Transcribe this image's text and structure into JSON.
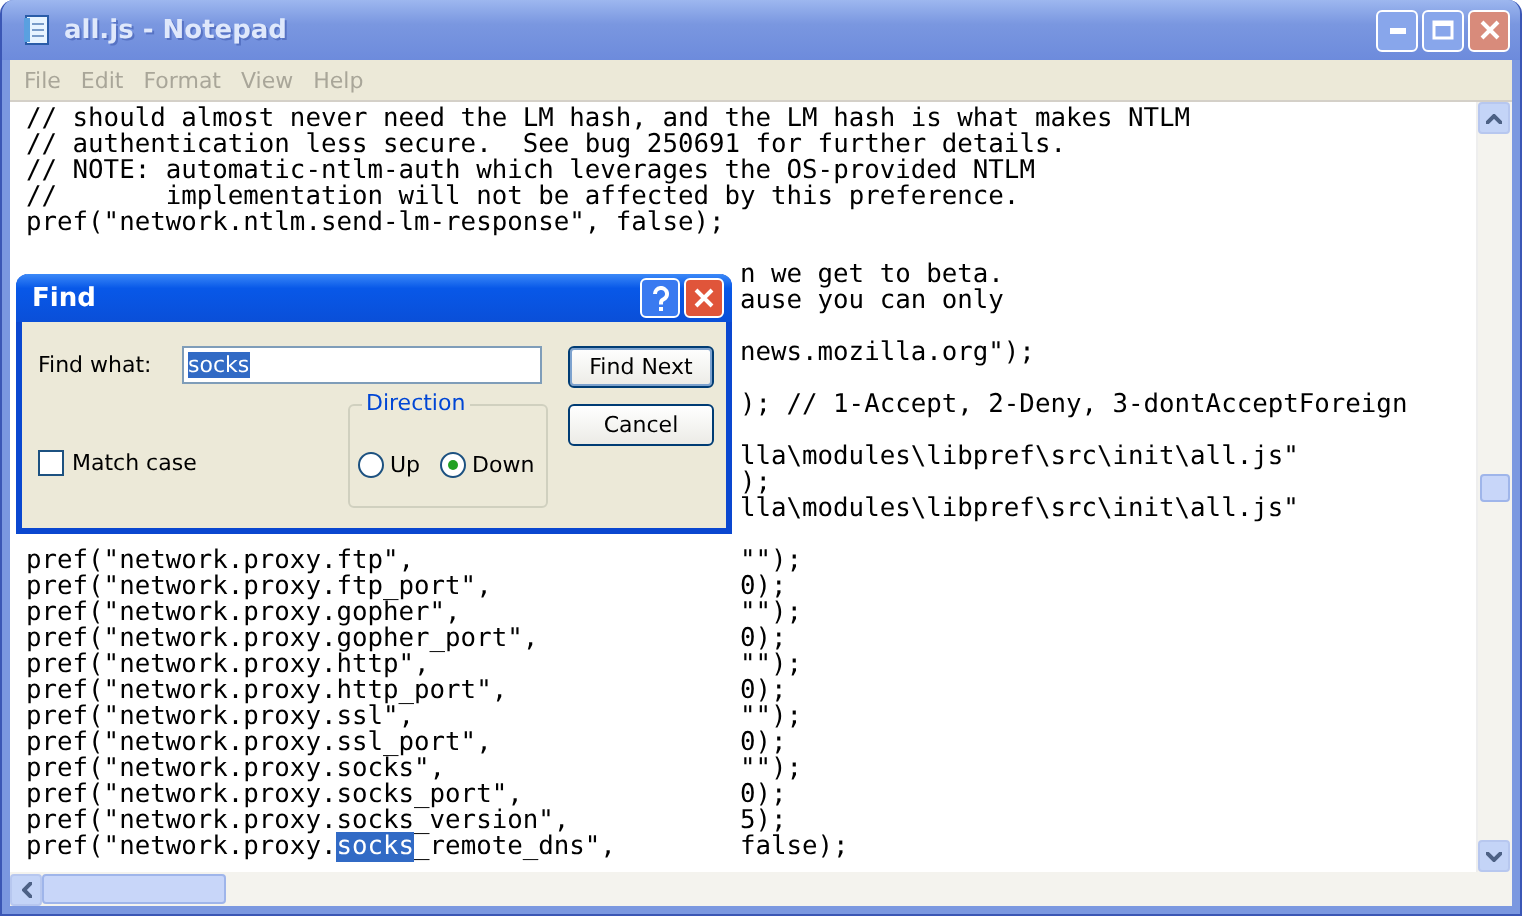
{
  "window": {
    "title": "all.js - Notepad"
  },
  "menu": [
    {
      "label": "File"
    },
    {
      "label": "Edit"
    },
    {
      "label": "Format"
    },
    {
      "label": "View"
    },
    {
      "label": "Help"
    }
  ],
  "editor": {
    "lines": [
      {
        "kind": "text",
        "text": "// should almost never need the LM hash, and the LM hash is what makes NTLM"
      },
      {
        "kind": "text",
        "text": "// authentication less secure.  See bug 250691 for further details."
      },
      {
        "kind": "text",
        "text": "// NOTE: automatic-ntlm-auth which leverages the OS-provided NTLM"
      },
      {
        "kind": "text",
        "text": "//       implementation will not be affected by this preference."
      },
      {
        "kind": "text",
        "text": "pref(\"network.ntlm.send-lm-response\", false);"
      },
      {
        "kind": "blank"
      },
      {
        "kind": "covered",
        "text": "n we get to beta."
      },
      {
        "kind": "covered",
        "text": "ause you can only"
      },
      {
        "kind": "blank"
      },
      {
        "kind": "covered",
        "text": "news.mozilla.org\");"
      },
      {
        "kind": "blank"
      },
      {
        "kind": "covered",
        "text": "); // 1-Accept, 2-Deny, 3-dontAcceptForeign"
      },
      {
        "kind": "blank"
      },
      {
        "kind": "covered",
        "text": "lla\\modules\\libpref\\src\\init\\all.js\""
      },
      {
        "kind": "covered",
        "text": ");"
      },
      {
        "kind": "covered",
        "text": "lla\\modules\\libpref\\src\\init\\all.js\""
      },
      {
        "kind": "blank"
      },
      {
        "kind": "pref",
        "key": [
          {
            "text": "pref(\"network.proxy.ftp\",",
            "selected": false
          }
        ],
        "value": "\"\");"
      },
      {
        "kind": "pref",
        "key": [
          {
            "text": "pref(\"network.proxy.ftp_port\",",
            "selected": false
          }
        ],
        "value": "0);"
      },
      {
        "kind": "pref",
        "key": [
          {
            "text": "pref(\"network.proxy.gopher\",",
            "selected": false
          }
        ],
        "value": "\"\");"
      },
      {
        "kind": "pref",
        "key": [
          {
            "text": "pref(\"network.proxy.gopher_port\",",
            "selected": false
          }
        ],
        "value": "0);"
      },
      {
        "kind": "pref",
        "key": [
          {
            "text": "pref(\"network.proxy.http\",",
            "selected": false
          }
        ],
        "value": "\"\");"
      },
      {
        "kind": "pref",
        "key": [
          {
            "text": "pref(\"network.proxy.http_port\",",
            "selected": false
          }
        ],
        "value": "0);"
      },
      {
        "kind": "pref",
        "key": [
          {
            "text": "pref(\"network.proxy.ssl\",",
            "selected": false
          }
        ],
        "value": "\"\");"
      },
      {
        "kind": "pref",
        "key": [
          {
            "text": "pref(\"network.proxy.ssl_port\",",
            "selected": false
          }
        ],
        "value": "0);"
      },
      {
        "kind": "pref",
        "key": [
          {
            "text": "pref(\"network.proxy.socks\",",
            "selected": false
          }
        ],
        "value": "\"\");"
      },
      {
        "kind": "pref",
        "key": [
          {
            "text": "pref(\"network.proxy.socks_port\",",
            "selected": false
          }
        ],
        "value": "0);"
      },
      {
        "kind": "pref",
        "key": [
          {
            "text": "pref(\"network.proxy.socks_version\",",
            "selected": false
          }
        ],
        "value": "5);"
      },
      {
        "kind": "pref",
        "key": [
          {
            "text": "pref(\"network.proxy.",
            "selected": false
          },
          {
            "text": "socks",
            "selected": true
          },
          {
            "text": "_remote_dns\",",
            "selected": false
          }
        ],
        "value": "false);"
      }
    ]
  },
  "find_dialog": {
    "title": "Find",
    "find_what_label": "Find what:",
    "find_what_value": "socks",
    "value_selected": true,
    "find_next_button": "Find Next",
    "cancel_button": "Cancel",
    "direction": {
      "label": "Direction",
      "options": [
        {
          "label": "Up",
          "selected": false
        },
        {
          "label": "Down",
          "selected": true
        }
      ]
    },
    "match_case": {
      "label": "Match case",
      "checked": false
    }
  }
}
